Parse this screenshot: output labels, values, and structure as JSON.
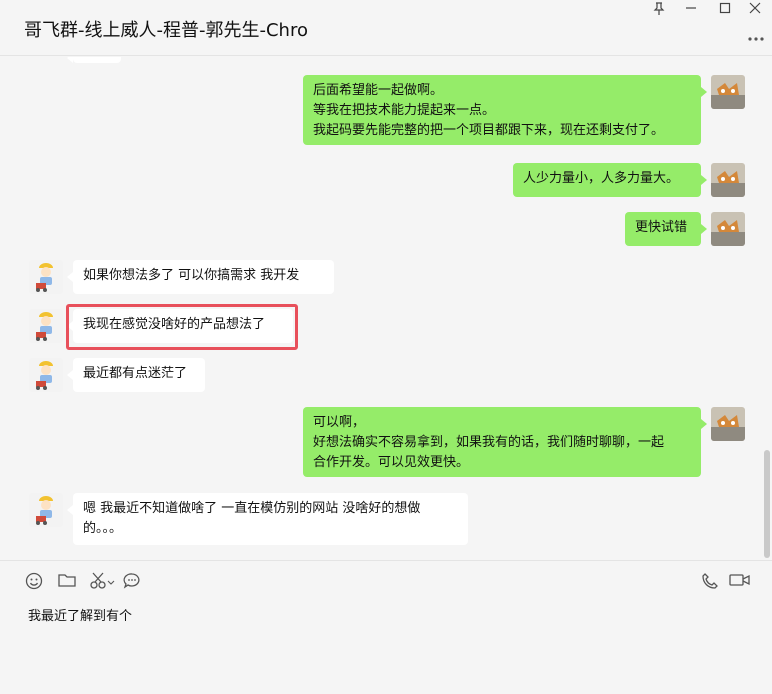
{
  "window": {
    "title": "哥飞群-线上威人-程普-郭先生-Chro",
    "pin_icon": "pin-icon",
    "minimize_icon": "minimize-icon",
    "maximize_icon": "maximize-icon",
    "close_icon": "close-icon",
    "more_icon": "more-icon"
  },
  "messages": [
    {
      "side": "right",
      "lines": [
        "后面希望能一起做啊。",
        "等我在把技术能力提起来一点。",
        "我起码要先能完整的把一个项目都跟下来，现在还剩支付了。"
      ]
    },
    {
      "side": "right",
      "lines": [
        "人少力量小，人多力量大。"
      ]
    },
    {
      "side": "right",
      "lines": [
        "更快试错"
      ]
    },
    {
      "side": "left",
      "lines": [
        "如果你想法多了  可以你搞需求  我开发"
      ]
    },
    {
      "side": "left",
      "lines": [
        "我现在感觉没啥好的产品想法了"
      ]
    },
    {
      "side": "left",
      "lines": [
        "最近都有点迷茫了"
      ]
    },
    {
      "side": "right",
      "lines": [
        "可以啊，",
        "好想法确实不容易拿到，如果我有的话，我们随时聊聊，一起",
        "合作开发。可以见效更快。"
      ]
    },
    {
      "side": "left",
      "lines": [
        "嗯  我最近不知道做啥了  一直在模仿别的网站  没啥好的想做",
        "的。。。"
      ]
    }
  ],
  "toolbar": {
    "emoji_icon": "emoji-icon",
    "folder_icon": "folder-icon",
    "scissors_icon": "scissors-icon",
    "chat_icon": "chat-bubble-icon",
    "phone_icon": "phone-icon",
    "video_icon": "video-icon"
  },
  "input": {
    "value": "我最近了解到有个"
  },
  "colors": {
    "own_bubble": "#95ec69",
    "other_bubble": "#ffffff",
    "highlight": "#e8505b",
    "background": "#f5f5f5"
  }
}
